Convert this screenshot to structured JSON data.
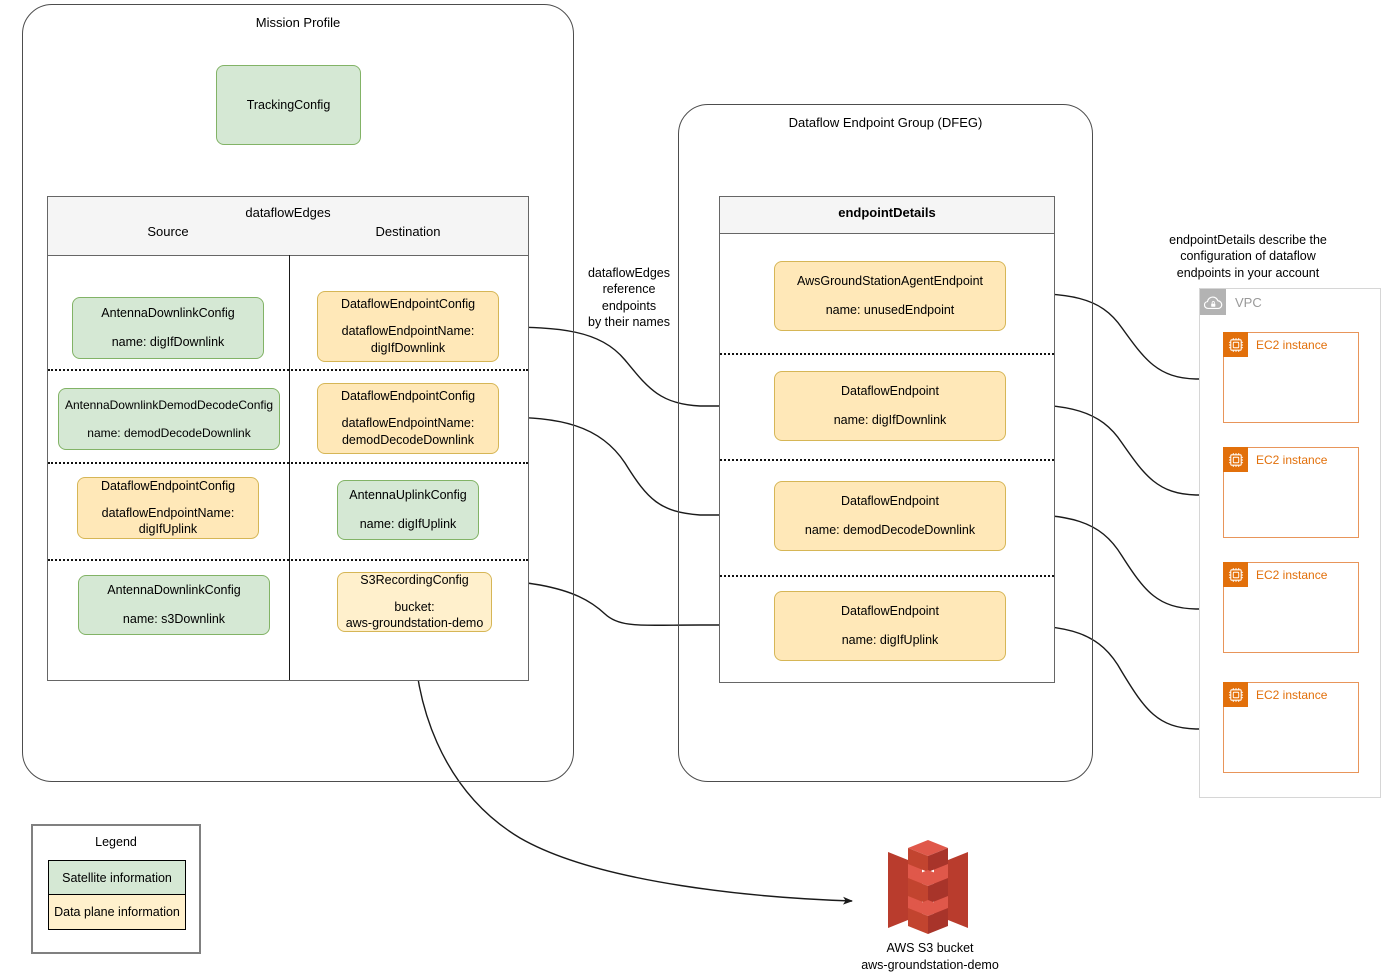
{
  "diagram": {
    "mission_profile": {
      "title": "Mission Profile",
      "tracking_config": {
        "label": "TrackingConfig"
      },
      "dataflow_edges": {
        "title": "dataflowEdges",
        "columns": [
          "Source",
          "Destination"
        ],
        "rows": [
          {
            "source": {
              "type": "AntennaDownlinkConfig",
              "detail": "name: digIfDownlink",
              "kind": "satellite"
            },
            "destination": {
              "type": "DataflowEndpointConfig",
              "detail": "dataflowEndpointName:\ndigIfDownlink",
              "kind": "data"
            }
          },
          {
            "source": {
              "type": "AntennaDownlinkDemodDecodeConfig",
              "detail": "name: demodDecodeDownlink",
              "kind": "satellite"
            },
            "destination": {
              "type": "DataflowEndpointConfig",
              "detail": "dataflowEndpointName:\ndemodDecodeDownlink",
              "kind": "data"
            }
          },
          {
            "source": {
              "type": "DataflowEndpointConfig",
              "detail": "dataflowEndpointName:\ndigIfUplink",
              "kind": "data"
            },
            "destination": {
              "type": "AntennaUplinkConfig",
              "detail": "name: digIfUplink",
              "kind": "satellite"
            }
          },
          {
            "source": {
              "type": "AntennaDownlinkConfig",
              "detail": "name: s3Downlink",
              "kind": "satellite"
            },
            "destination": {
              "type": "S3RecordingConfig",
              "detail": "bucket:\naws-groundstation-demo",
              "kind": "data"
            }
          }
        ]
      }
    },
    "dfeg": {
      "title": "Dataflow Endpoint Group (DFEG)",
      "endpoint_details": {
        "title": "endpointDetails",
        "endpoints": [
          {
            "type": "AwsGroundStationAgentEndpoint",
            "detail": "name: unusedEndpoint"
          },
          {
            "type": "DataflowEndpoint",
            "detail": "name: digIfDownlink"
          },
          {
            "type": "DataflowEndpoint",
            "detail": "name: demodDecodeDownlink"
          },
          {
            "type": "DataflowEndpoint",
            "detail": "name: digIfUplink"
          }
        ]
      }
    },
    "annotations": {
      "edges_reference": "dataflowEdges\nreference\nendpoints\nby their names",
      "endpoint_details_describe": "endpointDetails describe the\nconfiguration of dataflow\nendpoints in your account"
    },
    "vpc": {
      "label": "VPC",
      "icon": "vpc-cloud-lock-icon",
      "instances": [
        {
          "label": "EC2 instance",
          "icon": "ec2-chip-icon"
        },
        {
          "label": "EC2 instance",
          "icon": "ec2-chip-icon"
        },
        {
          "label": "EC2 instance",
          "icon": "ec2-chip-icon"
        },
        {
          "label": "EC2 instance",
          "icon": "ec2-chip-icon"
        }
      ]
    },
    "s3": {
      "icon": "aws-s3-bucket-icon",
      "caption_line1": "AWS S3 bucket",
      "caption_line2": "aws-groundstation-demo"
    },
    "legend": {
      "title": "Legend",
      "items": [
        {
          "label": "Satellite information",
          "kind": "satellite"
        },
        {
          "label": "Data plane information",
          "kind": "data"
        }
      ]
    },
    "colors": {
      "satellite_fill": "#d5e8d4",
      "satellite_stroke": "#82b366",
      "data_fill": "#ffe8b8",
      "data_stroke": "#d6b656",
      "container_stroke": "#4d4d4d",
      "table_header_fill": "#f5f5f5",
      "ec2_orange": "#e2700b",
      "vpc_grey": "#999999",
      "s3_red": "#c8442f",
      "wire": "#1a1a1a"
    }
  }
}
